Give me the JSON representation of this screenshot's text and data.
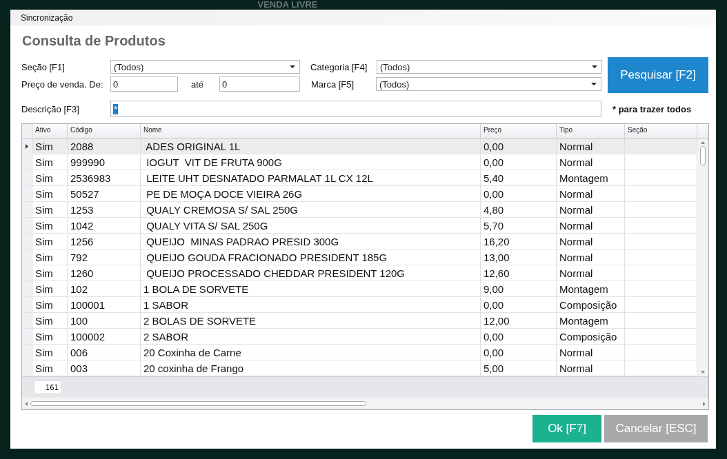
{
  "background_title": "VENDA LIVRE",
  "menu": [
    {
      "label": "Sincronização"
    }
  ],
  "title": "Consulta de Produtos",
  "filters": {
    "secao": {
      "label": "Seção [F1]",
      "value": "(Todos)"
    },
    "categoria": {
      "label": "Categoria [F4]",
      "value": "(Todos)"
    },
    "preco_de": {
      "label": "Preço de venda. De:",
      "value": "0"
    },
    "preco_ate": {
      "label": "até",
      "value": "0"
    },
    "marca": {
      "label": "Marca [F5]",
      "value": "(Todos)"
    },
    "descricao": {
      "label": "Descrição [F3]",
      "value": "*"
    },
    "hint": "* para trazer todos"
  },
  "search_button": "Pesquisar [F2]",
  "table": {
    "columns": [
      "Ativo",
      "Código",
      "Nome",
      "Preço",
      "Tipo",
      "Seção"
    ],
    "rows": [
      {
        "cells": [
          "Sim",
          "2088",
          " ADES ORIGINAL 1L",
          "0,00",
          "Normal",
          ""
        ],
        "selected": true
      },
      {
        "cells": [
          "Sim",
          "999990",
          " IOGUT  VIT DE FRUTA 900G",
          "0,00",
          "Normal",
          ""
        ],
        "selected": false
      },
      {
        "cells": [
          "Sim",
          "2536983",
          " LEITE UHT DESNATADO PARMALAT 1L CX 12L",
          "5,40",
          "Montagem",
          ""
        ],
        "selected": false
      },
      {
        "cells": [
          "Sim",
          "50527",
          " PE DE MOÇA DOCE VIEIRA 26G",
          "0,00",
          "Normal",
          ""
        ],
        "selected": false
      },
      {
        "cells": [
          "Sim",
          "1253",
          " QUALY CREMOSA S/ SAL 250G",
          "4,80",
          "Normal",
          ""
        ],
        "selected": false
      },
      {
        "cells": [
          "Sim",
          "1042",
          " QUALY VITA S/ SAL 250G",
          "5,70",
          "Normal",
          ""
        ],
        "selected": false
      },
      {
        "cells": [
          "Sim",
          "1256",
          " QUEIJO  MINAS PADRAO PRESID 300G",
          "16,20",
          "Normal",
          ""
        ],
        "selected": false
      },
      {
        "cells": [
          "Sim",
          "792",
          " QUEIJO GOUDA FRACIONADO PRESIDENT 185G",
          "13,00",
          "Normal",
          ""
        ],
        "selected": false
      },
      {
        "cells": [
          "Sim",
          "1260",
          " QUEIJO PROCESSADO CHEDDAR PRESIDENT 120G",
          "12,60",
          "Normal",
          ""
        ],
        "selected": false
      },
      {
        "cells": [
          "Sim",
          "102",
          "1 BOLA DE SORVETE",
          "9,00",
          "Montagem",
          ""
        ],
        "selected": false
      },
      {
        "cells": [
          "Sim",
          "100001",
          "1 SABOR",
          "0,00",
          "Composição",
          ""
        ],
        "selected": false
      },
      {
        "cells": [
          "Sim",
          "100",
          "2 BOLAS DE SORVETE",
          "12,00",
          "Montagem",
          ""
        ],
        "selected": false
      },
      {
        "cells": [
          "Sim",
          "100002",
          "2 SABOR",
          "0,00",
          "Composição",
          ""
        ],
        "selected": false
      },
      {
        "cells": [
          "Sim",
          "006",
          "20 Coxinha de Carne",
          "0,00",
          "Normal",
          ""
        ],
        "selected": false
      },
      {
        "cells": [
          "Sim",
          "003",
          "20 coxinha de Frango",
          "5,00",
          "Normal",
          ""
        ],
        "selected": false
      }
    ],
    "count": "161"
  },
  "buttons": [
    {
      "label": "Ok [F7]",
      "kind": "primary"
    },
    {
      "label": "Cancelar [ESC]",
      "kind": "secondary"
    }
  ]
}
